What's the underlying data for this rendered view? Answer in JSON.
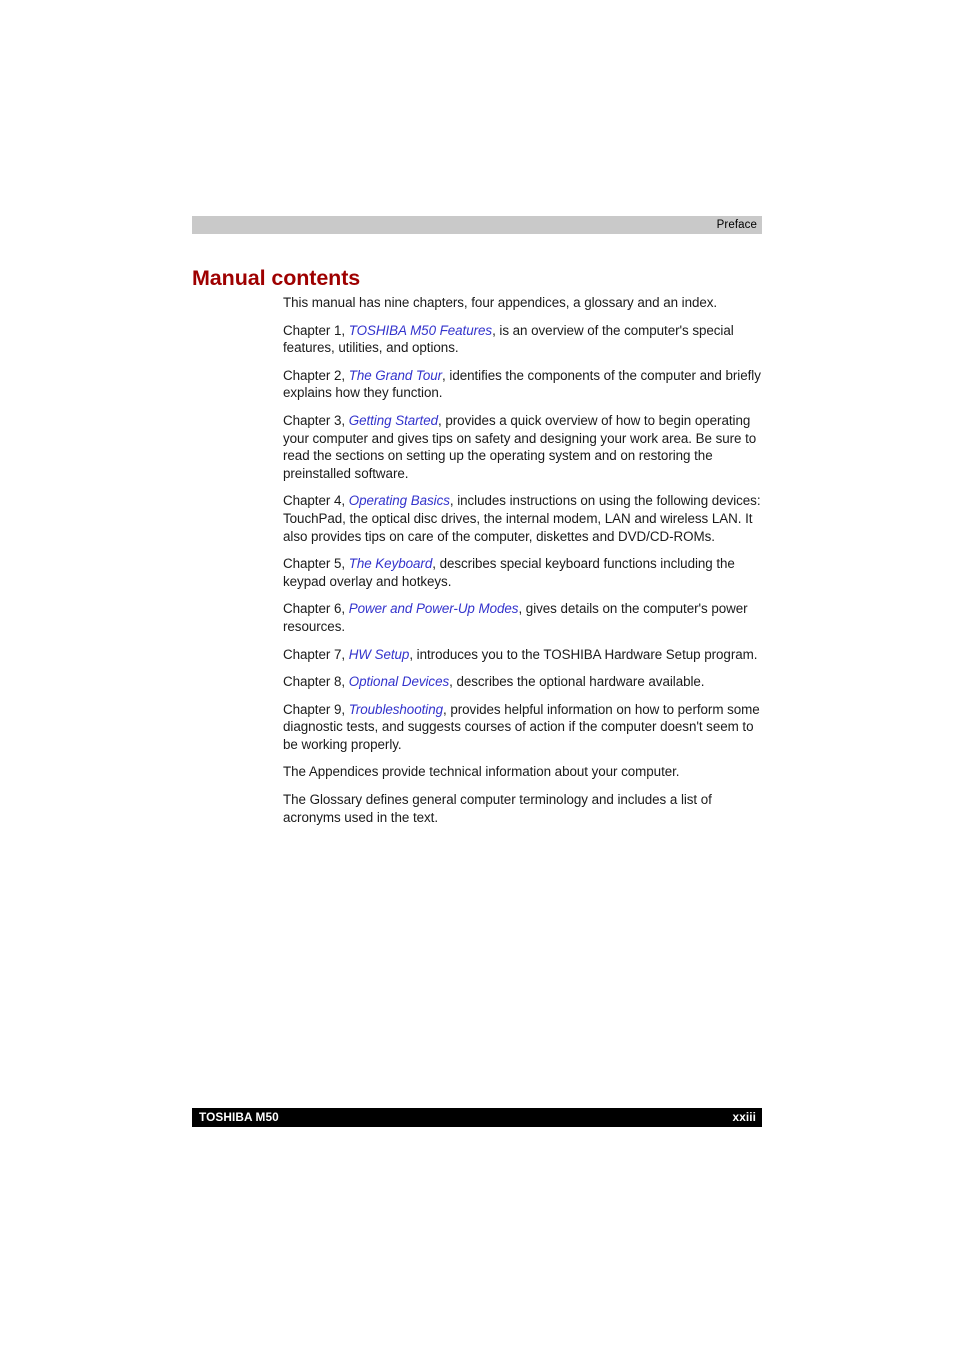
{
  "page": {
    "running_header": "Preface",
    "running_footer_left": "TOSHIBA M50",
    "running_footer_right": "xxiii",
    "heading": "Manual contents"
  },
  "colors": {
    "heading": "#9e0000",
    "xref_link": "#3333cc",
    "header_bar_bg": "#c9c9c9",
    "footer_bar_bg": "#000000",
    "footer_text": "#ffffff",
    "body_text": "#1a1a1a"
  },
  "body": {
    "intro": "This manual has nine chapters, four appendices, a glossary and an index.",
    "chapters": [
      {
        "lead": "Chapter 1, ",
        "xref": "TOSHIBA M50 Features",
        "tail": ", is an overview of the computer's special features, utilities, and options."
      },
      {
        "lead": "Chapter 2, ",
        "xref": "The Grand Tour",
        "tail": ", identifies the components of the computer and briefly explains how they function."
      },
      {
        "lead": "Chapter 3, ",
        "xref": "Getting Started",
        "tail": ", provides a quick overview of how to begin operating your computer and gives tips on safety and designing your work area. Be sure to read the sections on setting up the operating system and on restoring the preinstalled software."
      },
      {
        "lead": "Chapter 4, ",
        "xref": "Operating Basics",
        "tail": ", includes instructions on using the following devices: TouchPad, the optical disc drives, the internal modem, LAN and wireless LAN. It also provides tips on care of the computer, diskettes and DVD/CD-ROMs."
      },
      {
        "lead": "Chapter 5, ",
        "xref": "The Keyboard",
        "tail": ", describes special keyboard functions including the keypad overlay and hotkeys."
      },
      {
        "lead": "Chapter 6, ",
        "xref": "Power and Power-Up Modes",
        "tail": ", gives details on the computer's power resources."
      },
      {
        "lead": "Chapter 7, ",
        "xref": "HW Setup",
        "tail": ", introduces you to the TOSHIBA Hardware Setup program."
      },
      {
        "lead": "Chapter 8, ",
        "xref": "Optional Devices",
        "tail": ", describes the optional hardware available."
      },
      {
        "lead": "Chapter 9, ",
        "xref": "Troubleshooting",
        "tail": ", provides helpful information on how to perform some diagnostic tests, and suggests courses of action if the computer doesn't seem to be working properly."
      }
    ],
    "appendices_note": "The Appendices provide technical information about your computer.",
    "glossary_note": "The Glossary defines general computer terminology and includes a list of acronyms used in the text."
  }
}
